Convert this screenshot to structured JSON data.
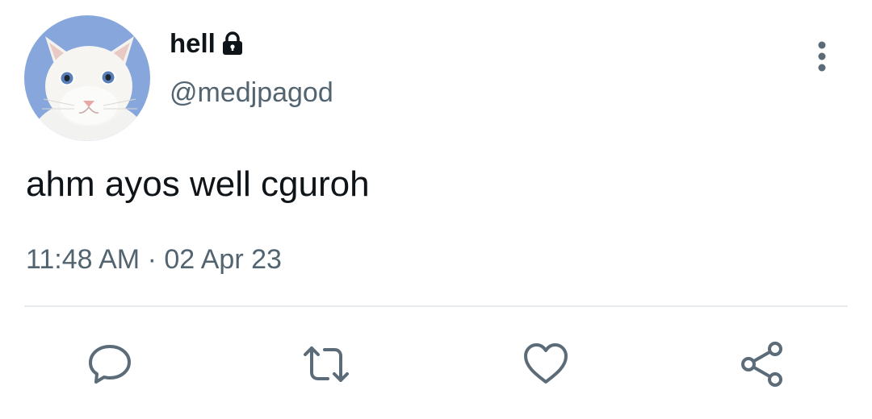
{
  "tweet": {
    "display_name": "hell",
    "protected_icon": "lock-icon",
    "handle": "@medjpagod",
    "text": "ahm ayos well cguroh",
    "timestamp": "11:48 AM · 02 Apr 23"
  },
  "actions": [
    {
      "name": "reply",
      "icon": "speech-bubble-icon"
    },
    {
      "name": "retweet",
      "icon": "retweet-arrows-icon"
    },
    {
      "name": "like",
      "icon": "heart-icon"
    },
    {
      "name": "share",
      "icon": "share-nodes-icon"
    }
  ],
  "colors": {
    "text_primary": "#0f1419",
    "text_secondary": "#536471",
    "icon_gray": "#5b6b78",
    "divider": "#e6eaed",
    "avatar_background": "#87a7dc"
  }
}
